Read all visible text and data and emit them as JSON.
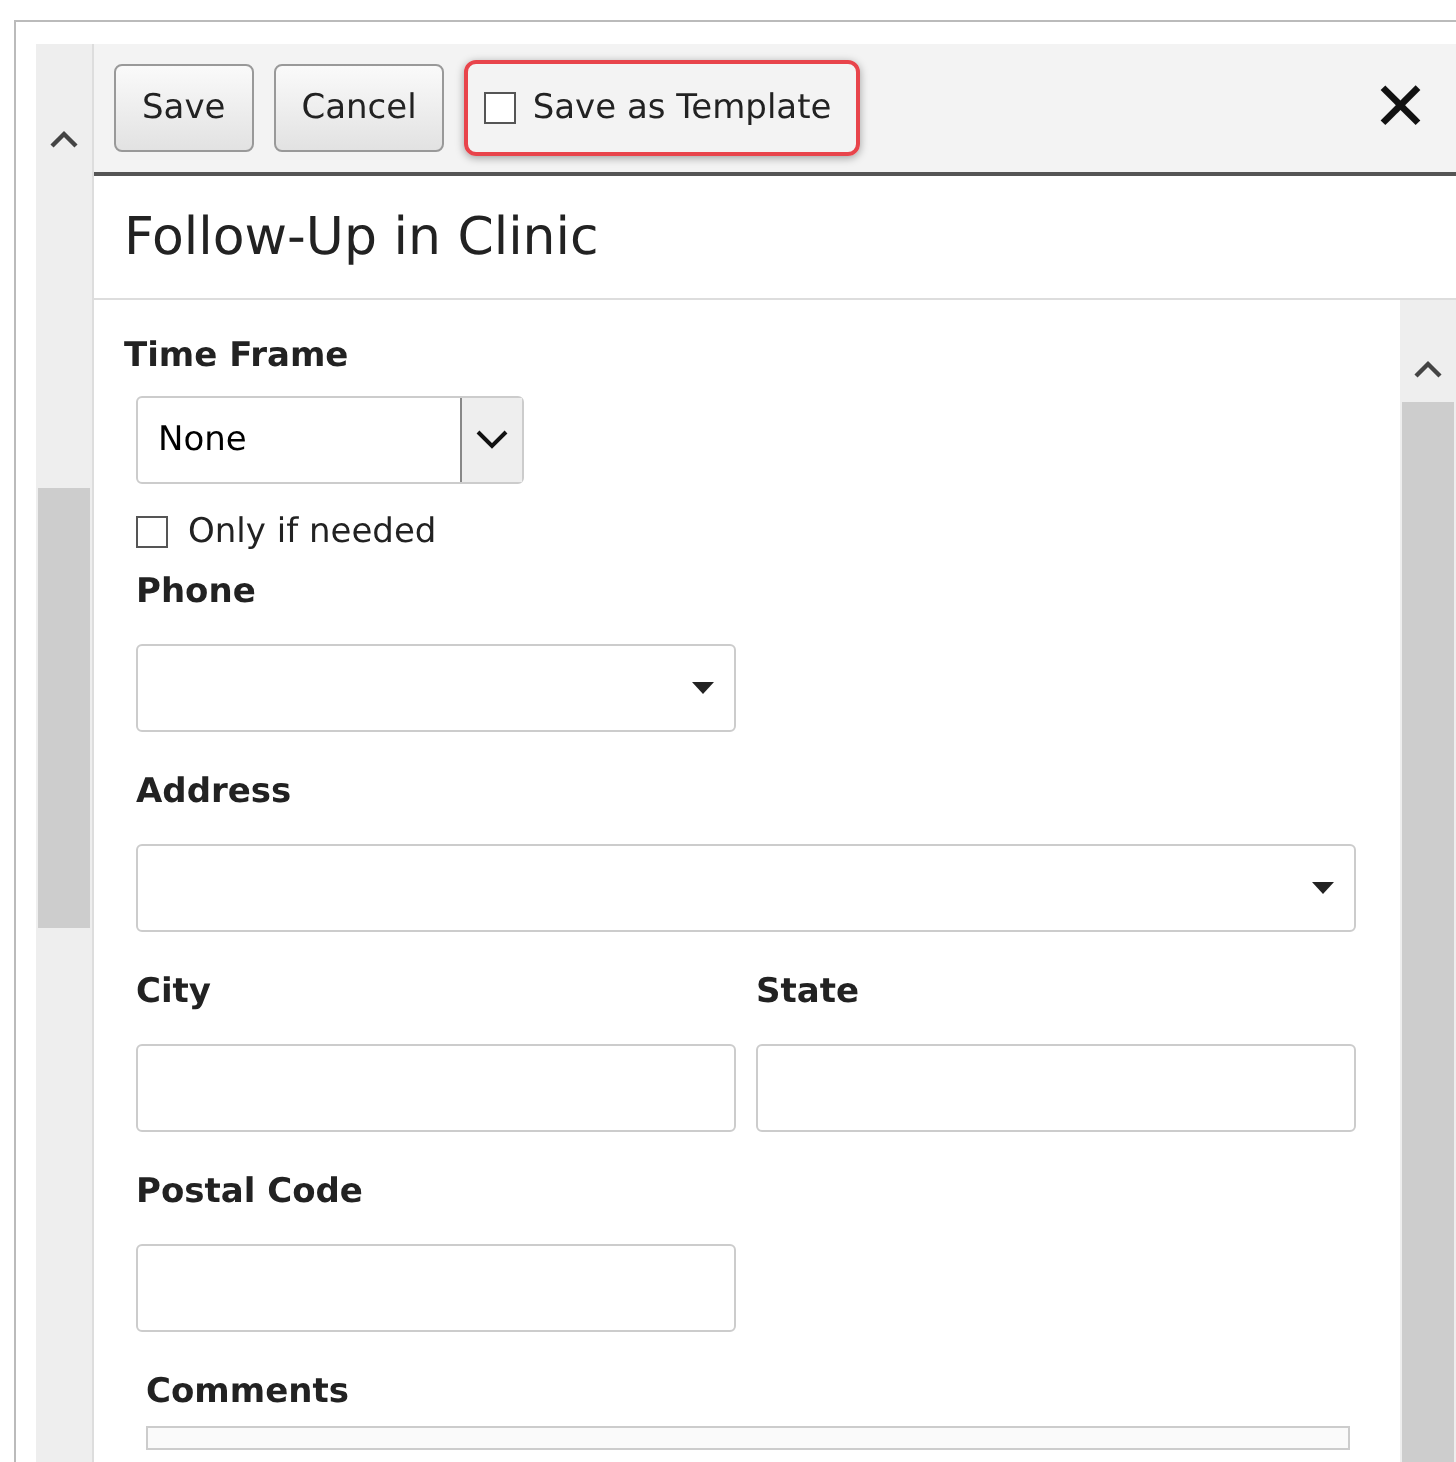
{
  "toolbar": {
    "buttons": [
      "Save",
      "Cancel"
    ],
    "template_option": {
      "label": "Save as Template",
      "checked": false,
      "highlighted": true
    },
    "close": "✕"
  },
  "title": "Follow-Up in Clinic",
  "form": {
    "time_frame": {
      "label": "Time Frame",
      "value": "None"
    },
    "only_if_needed": {
      "label": "Only if needed",
      "checked": false
    },
    "phone": {
      "label": "Phone"
    },
    "address": {
      "label": "Address"
    },
    "city": {
      "label": "City"
    },
    "state": {
      "label": "State"
    },
    "postal_code": {
      "label": "Postal Code"
    },
    "comments": {
      "label": "Comments"
    }
  }
}
